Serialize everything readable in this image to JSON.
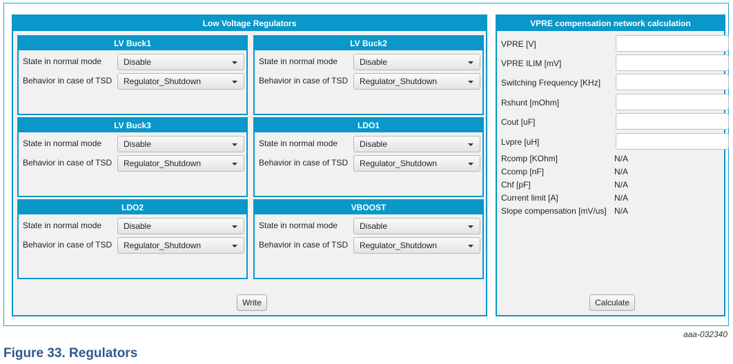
{
  "left_panel": {
    "title": "Low Voltage Regulators",
    "groups": [
      {
        "title": "LV Buck1",
        "state_label": "State in normal mode",
        "state_value": "Disable",
        "tsd_label": "Behavior in case of TSD",
        "tsd_value": "Regulator_Shutdown"
      },
      {
        "title": "LV Buck2",
        "state_label": "State in normal mode",
        "state_value": "Disable",
        "tsd_label": "Behavior in case of TSD",
        "tsd_value": "Regulator_Shutdown"
      },
      {
        "title": "LV Buck3",
        "state_label": "State in normal mode",
        "state_value": "Disable",
        "tsd_label": "Behavior in case of TSD",
        "tsd_value": "Regulator_Shutdown"
      },
      {
        "title": "LDO1",
        "state_label": "State in normal mode",
        "state_value": "Disable",
        "tsd_label": "Behavior in case of TSD",
        "tsd_value": "Regulator_Shutdown"
      },
      {
        "title": "LDO2",
        "state_label": "State in normal mode",
        "state_value": "Disable",
        "tsd_label": "Behavior in case of TSD",
        "tsd_value": "Regulator_Shutdown"
      },
      {
        "title": "VBOOST",
        "state_label": "State in normal mode",
        "state_value": "Disable",
        "tsd_label": "Behavior in case of TSD",
        "tsd_value": "Regulator_Shutdown"
      }
    ],
    "write_label": "Write"
  },
  "right_panel": {
    "title": "VPRE compensation network calculation",
    "inputs": [
      {
        "label": "VPRE [V]",
        "value": ""
      },
      {
        "label": "VPRE ILIM [mV]",
        "value": ""
      },
      {
        "label": "Switching Frequency [KHz]",
        "value": ""
      },
      {
        "label": "Rshunt [mOhm]",
        "value": ""
      },
      {
        "label": "Cout [uF]",
        "value": ""
      },
      {
        "label": "Lvpre [uH]",
        "value": ""
      }
    ],
    "outputs": [
      {
        "label": "Rcomp [KOhm]",
        "value": "N/A"
      },
      {
        "label": "Ccomp [nF]",
        "value": "N/A"
      },
      {
        "label": "Chf [pF]",
        "value": "N/A"
      },
      {
        "label": "Current limit [A]",
        "value": "N/A"
      },
      {
        "label": "Slope compensation [mV/us]",
        "value": "N/A"
      }
    ],
    "calculate_label": "Calculate"
  },
  "figure_id": "aaa-032340",
  "caption": "Figure 33. Regulators",
  "colors": {
    "accent": "#0a97c9",
    "caption": "#2c5b8d",
    "panel_bg": "#f1f1f1"
  }
}
